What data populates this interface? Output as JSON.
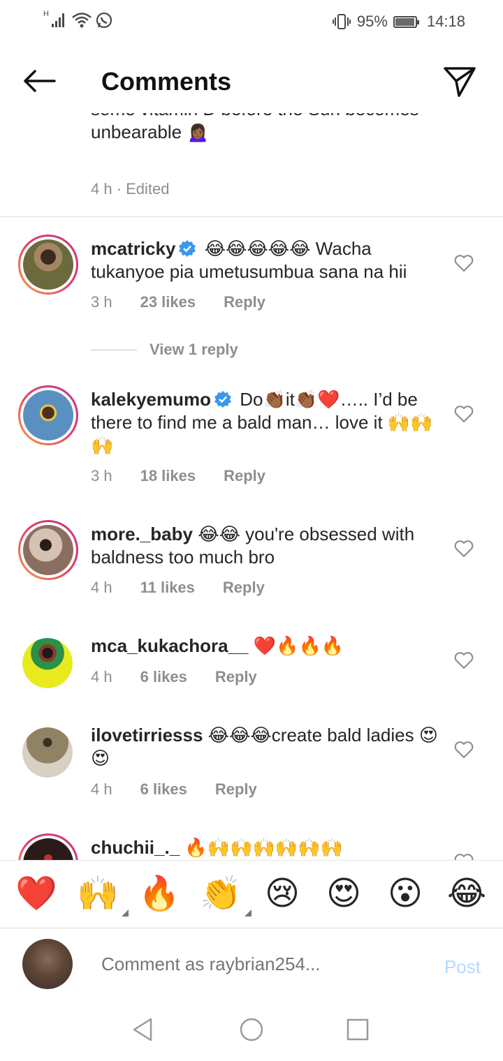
{
  "status_bar": {
    "signal_label": "H",
    "battery": "95%",
    "battery_level": 0.95,
    "time": "14:18"
  },
  "header": {
    "title": "Comments",
    "back_icon": "arrow-left-icon",
    "send_icon": "paper-plane-icon"
  },
  "caption": {
    "text": "some vitamin D before the Sun becomes unbearable 🙍🏾‍♀️",
    "meta": "4 h · Edited"
  },
  "comments": [
    {
      "username": "mcatricky",
      "verified": true,
      "text": "😂😂😂😂😂 Wacha tukanyoe pia umetusumbua sana na hii",
      "time": "3 h",
      "likes": "23 likes",
      "reply": "Reply",
      "view_replies": "View 1 reply",
      "avatar_color": "#8a7a56"
    },
    {
      "username": "kalekyemumo",
      "verified": true,
      "text": "Do👏🏾it👏🏾❤️….. I’d be there to find me a bald man… love it 🙌🙌🙌",
      "time": "3 h",
      "likes": "18 likes",
      "reply": "Reply",
      "avatar_color": "#4d8fc9"
    },
    {
      "username": "more._baby",
      "verified": false,
      "text": "😂😂 you're obsessed with baldness too much bro",
      "time": "4 h",
      "likes": "11 likes",
      "reply": "Reply",
      "avatar_color": "#b8a08c"
    },
    {
      "username": "mca_kukachora__",
      "verified": false,
      "text": "❤️🔥🔥🔥",
      "time": "4 h",
      "likes": "6 likes",
      "reply": "Reply",
      "avatar_color": "#e8ea1f"
    },
    {
      "username": "ilovetirriesss",
      "verified": false,
      "text": "😂😂😂create bald ladies 😍😍",
      "time": "4 h",
      "likes": "6 likes",
      "reply": "Reply",
      "avatar_color": "#7a6e55"
    },
    {
      "username": "chuchii_._",
      "verified": false,
      "text": "🔥🙌🙌🙌🙌🙌🙌",
      "avatar_color": "#3a2222"
    }
  ],
  "emoji_bar": [
    "❤️",
    "🙌",
    "🔥",
    "👏",
    "😢",
    "😍",
    "😮",
    "😂"
  ],
  "composer": {
    "placeholder": "Comment as raybrian254...",
    "post_label": "Post"
  },
  "colors": {
    "accent_link_disabled": "#b3dbff",
    "verified_blue": "#3897f0",
    "story_ring_start": "#f9a13a",
    "story_ring_end": "#c13584"
  }
}
